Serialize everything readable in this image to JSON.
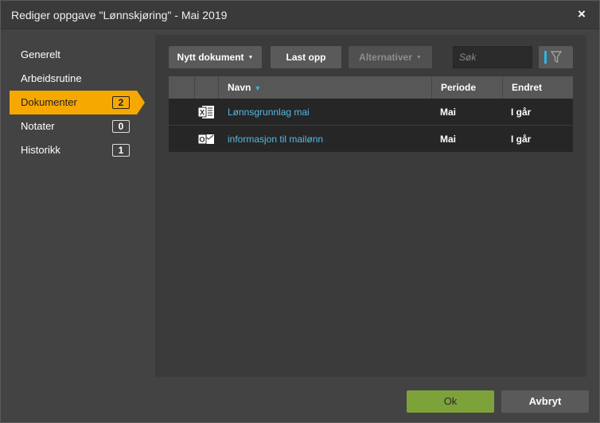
{
  "dialog": {
    "title": "Rediger oppgave \"Lønnskjøring\" - Mai 2019",
    "close_icon": "×"
  },
  "sidebar": {
    "items": [
      {
        "label": "Generelt",
        "badge": null,
        "active": false
      },
      {
        "label": "Arbeidsrutine",
        "badge": null,
        "active": false
      },
      {
        "label": "Dokumenter",
        "badge": "2",
        "active": true
      },
      {
        "label": "Notater",
        "badge": "0",
        "active": false
      },
      {
        "label": "Historikk",
        "badge": "1",
        "active": false
      }
    ]
  },
  "toolbar": {
    "new_document_label": "Nytt dokument",
    "upload_label": "Last opp",
    "alternatives_label": "Alternativer",
    "search_placeholder": "Søk"
  },
  "table": {
    "columns": {
      "name": "Navn",
      "period": "Periode",
      "changed": "Endret"
    },
    "rows": [
      {
        "icon": "excel-icon",
        "name": "Lønnsgrunnlag mai",
        "period": "Mai",
        "changed": "I går"
      },
      {
        "icon": "outlook-icon",
        "name": "informasjon til mailønn",
        "period": "Mai",
        "changed": "I går"
      }
    ]
  },
  "footer": {
    "ok_label": "Ok",
    "cancel_label": "Avbryt"
  },
  "colors": {
    "accent": "#f7a800",
    "link": "#56b9e2",
    "ok": "#7ea23a",
    "filter_bar": "#2fb4e6"
  }
}
